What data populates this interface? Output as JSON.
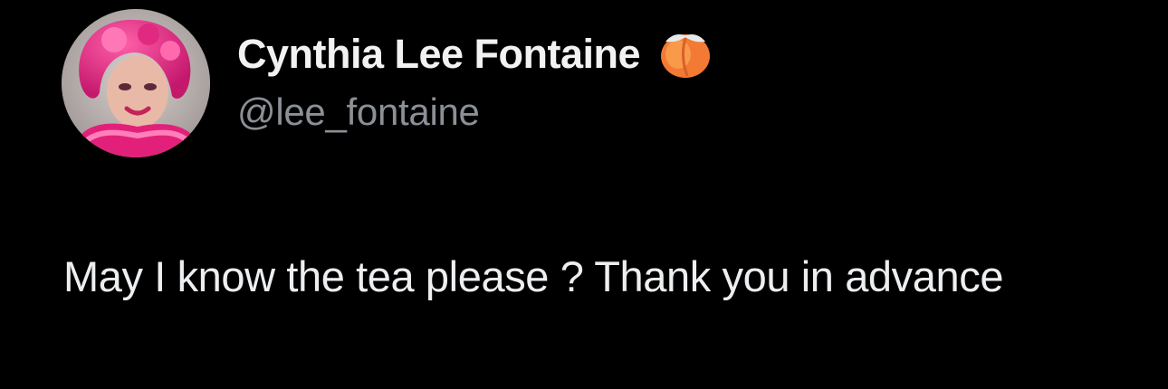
{
  "author": {
    "display_name": "Cynthia Lee Fontaine",
    "handle": "@lee_fontaine",
    "badge_icon": "peach-icon",
    "avatar": "profile-photo"
  },
  "tweet": {
    "text": "May I know the tea please ? Thank you in advance"
  },
  "colors": {
    "background": "#000000",
    "name": "#f2f2f2",
    "handle": "#8b9096",
    "body": "#eceef0",
    "peach": "#f4823a"
  }
}
